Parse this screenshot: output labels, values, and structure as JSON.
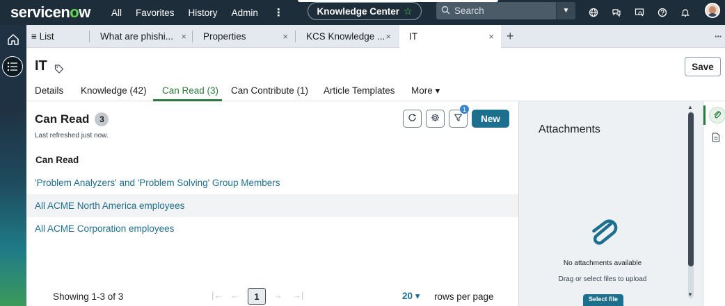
{
  "topnav": {
    "logo_prefix": "servicen",
    "logo_o": "o",
    "logo_suffix": "w",
    "links": [
      "All",
      "Favorites",
      "History",
      "Admin"
    ],
    "more": "⋮",
    "knowledge_center": "Knowledge Center",
    "search_placeholder": "Search"
  },
  "tabs": [
    {
      "label": "≡ List"
    },
    {
      "label": "What are phishi..."
    },
    {
      "label": "Properties"
    },
    {
      "label": "KCS Knowledge ..."
    },
    {
      "label": "IT"
    }
  ],
  "tab_close": "×",
  "tab_add": "+",
  "tab_more": "···",
  "header": {
    "title": "IT",
    "save_label": "Save"
  },
  "subtabs": [
    "Details",
    "Knowledge (42)",
    "Can Read (3)",
    "Can Contribute (1)",
    "Article Templates",
    "More ▾"
  ],
  "list": {
    "title": "Can Read",
    "count": "3",
    "refreshed": "Last refreshed just now.",
    "filter_count": "1",
    "new_label": "New",
    "column_header": "Can Read",
    "rows": [
      "'Problem Analyzers' and 'Problem Solving' Group Members",
      "All ACME North America employees",
      "All ACME Corporation employees"
    ]
  },
  "footer": {
    "showing": "Showing 1-3 of 3",
    "page": "1",
    "rows_per_page_value": "20 ▾",
    "rows_per_page_label": "rows per page"
  },
  "attachments": {
    "title": "Attachments",
    "empty": "No attachments available",
    "hint": "Drag or select files to upload",
    "select_label": "Select file"
  },
  "colors": {
    "accent_green": "#2b7a3c",
    "link_blue": "#1e6e8f",
    "primary_button": "#1d6f8e",
    "nav_bg": "#1d2d39"
  }
}
